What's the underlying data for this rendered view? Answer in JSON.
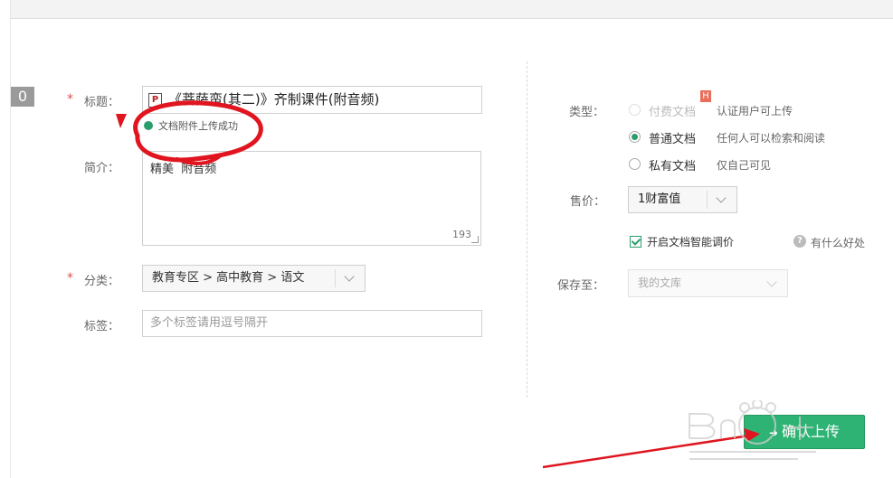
{
  "badge_number": "0",
  "form": {
    "required_mark": "*",
    "title_label": "标题：",
    "title_value": "《菩萨蛮(其二)》齐制课件(附音频)",
    "file_type_icon": "P",
    "upload_status": "文档附件上传成功",
    "desc_label": "简介：",
    "desc_value": "精美  附音频",
    "desc_count": "193",
    "category_label": "分类：",
    "category_value": "教育专区 > 高中教育 > 语文",
    "tags_label": "标签：",
    "tags_placeholder": "多个标签请用逗号隔开"
  },
  "settings": {
    "type_label": "类型：",
    "types": [
      {
        "label": "付费文档",
        "note": "认证用户可上传",
        "selected": false,
        "disabled": true,
        "badge": "H"
      },
      {
        "label": "普通文档",
        "note": "任何人可以检索和阅读",
        "selected": true,
        "disabled": false
      },
      {
        "label": "私有文档",
        "note": "仅自己可见",
        "selected": false,
        "disabled": false
      }
    ],
    "price_label": "售价：",
    "price_value": "1财富值",
    "smart_price_label": "开启文档智能调价",
    "smart_price_checked": true,
    "help_icon_glyph": "?",
    "help_label": "有什么好处",
    "save_label": "保存至：",
    "save_value": "我的文库"
  },
  "confirm_button": "确认上传",
  "colors": {
    "accent": "#2fb374",
    "annotation": "#e0151f",
    "required": "#d9534f"
  },
  "icons": [
    "file-ppt-icon",
    "chevron-down-icon",
    "help-icon",
    "arrow-right-icon"
  ]
}
